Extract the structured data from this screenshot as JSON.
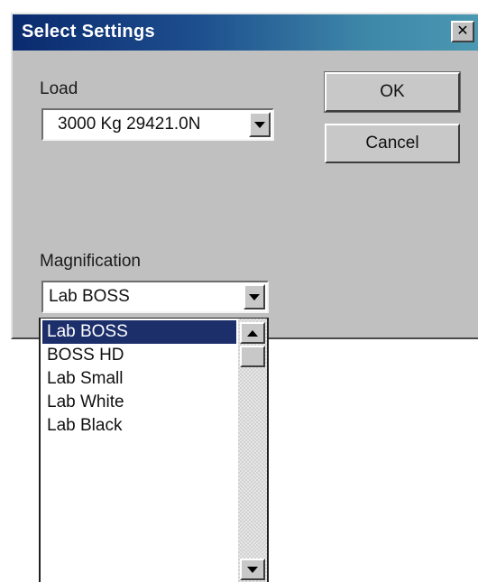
{
  "window": {
    "title": "Select Settings",
    "close_glyph": "✕"
  },
  "load": {
    "label": "Load",
    "selected_value": "3000 Kg  29421.0N"
  },
  "buttons": {
    "ok_label": "OK",
    "cancel_label": "Cancel"
  },
  "magnification": {
    "label": "Magnification",
    "selected_value": "Lab BOSS",
    "options": [
      "Lab BOSS",
      "BOSS HD",
      "Lab Small",
      "Lab White",
      "Lab Black"
    ],
    "highlighted_index": 0
  },
  "icons": {
    "close": "close-icon",
    "dropdown": "chevron-down-icon",
    "scroll_up": "scroll-up-arrow-icon",
    "scroll_down": "scroll-down-arrow-icon"
  },
  "colors": {
    "title_gradient_start": "#0a2a6e",
    "title_gradient_end": "#4a98b2",
    "dialog_face": "#c0c0c0",
    "selection": "#1d2f6b"
  }
}
